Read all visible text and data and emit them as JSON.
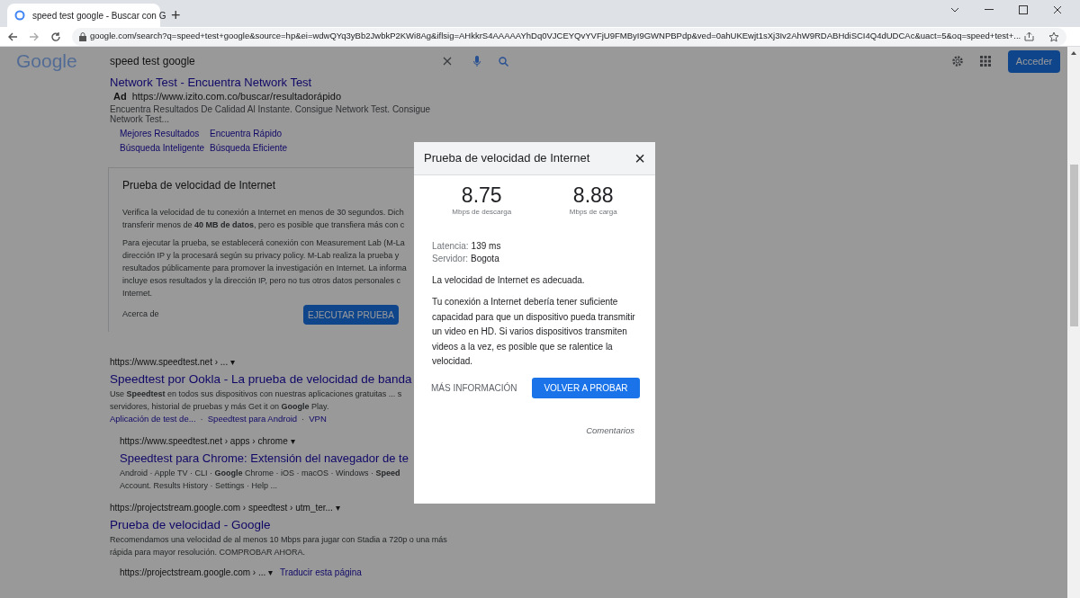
{
  "browser": {
    "tab_title": "speed test google - Buscar con G",
    "new_tab": "+",
    "url": "google.com/search?q=speed+test+google&source=hp&ei=wdwQYq3yBb2JwbkP2KWi8Ag&iflsig=AHkkrS4AAAAAYhDq0VJCEYQvYVFjU9FMByI9GWNPBPdp&ved=0ahUKEwjt1sXj3Iv2AhW9RDABHdiSCI4Q4dUDCAc&uact=5&oq=speed+test+..."
  },
  "google": {
    "logo": "Google",
    "search_value": "speed test google",
    "sign_in": "Acceder"
  },
  "ad": {
    "title": "Network Test - Encuentra Network Test",
    "label": "Ad",
    "url": "https://www.izito.com.co/buscar/resultadorápido",
    "description": "Encuentra Resultados De Calidad Al Instante. Consigue Network Test. Consigue Network Test...",
    "sitelinks": [
      [
        "Mejores Resultados",
        "Encuentra Rápido"
      ],
      [
        "Búsqueda Inteligente",
        "Búsqueda Eficiente"
      ]
    ]
  },
  "speed_card": {
    "title": "Prueba de velocidad de Internet",
    "paragraphs": [
      [
        "Verifica la velocidad de tu conexión a Internet en menos de 30 segundos. Dich",
        "transferir menos de **40 MB de datos**, pero es posible que transfiera más con c"
      ],
      [
        "Para ejecutar la prueba, se establecerá conexión con Measurement Lab (M-La",
        "dirección IP y la procesará según su privacy policy. M-Lab realiza la prueba y",
        "resultados públicamente para promover la investigación en Internet. La informa",
        "incluye esos resultados y la dirección IP, pero no tus otros datos personales c",
        "Internet."
      ]
    ],
    "about": "Acerca de",
    "run_button": "EJECUTAR PRUEBA"
  },
  "results": [
    {
      "url": "https://www.speedtest.net › ... ▾",
      "title": "Speedtest por Ookla - La prueba de velocidad de banda",
      "snippet": [
        "Use **Speedtest** en todos sus dispositivos con nuestras aplicaciones gratuitas ... s",
        "servidores, historial de pruebas y más Get it on **Google** Play."
      ],
      "links": [
        "Aplicación de test de...",
        "Speedtest para Android",
        "VPN"
      ],
      "link_separator": "·",
      "children": [
        {
          "url": "https://www.speedtest.net › apps › chrome ▾",
          "title": "Speedtest para Chrome: Extensión del navegador de te",
          "snippet": [
            "Android · Apple TV · CLI · **Google** Chrome · iOS · macOS · Windows · **Speed**",
            "Account. Results History · Settings · Help ..."
          ]
        }
      ]
    },
    {
      "url": "https://projectstream.google.com › speedtest › utm_ter... ▾",
      "title": "Prueba de velocidad - Google",
      "snippet": [
        "Recomendamos una velocidad de al menos 10 Mbps para jugar con Stadia a 720p o una más",
        "rápida para mayor resolución. COMPROBAR AHORA."
      ]
    }
  ],
  "last_result": {
    "url": "https://projectstream.google.com › ... ▾",
    "translate": "Traducir esta página"
  },
  "dialog": {
    "title": "Prueba de velocidad de Internet",
    "close": "×",
    "download": {
      "value": "8.75",
      "label": "Mbps de descarga"
    },
    "upload": {
      "value": "8.88",
      "label": "Mbps de carga"
    },
    "details": [
      {
        "label": "Latencia:",
        "value": "139 ms"
      },
      {
        "label": "Servidor:",
        "value": "Bogota"
      }
    ],
    "verdict": "La velocidad de Internet es adecuada.",
    "explanation": "Tu conexión a Internet debería tener suficiente capacidad para que un dispositivo pueda transmitir un video en HD. Si varios dispositivos transmiten videos a la vez, es posible que se ralentice la velocidad.",
    "more_button": "MÁS INFORMACIÓN",
    "retry_button": "VOLVER A PROBAR",
    "feedback": "Comentarios"
  }
}
